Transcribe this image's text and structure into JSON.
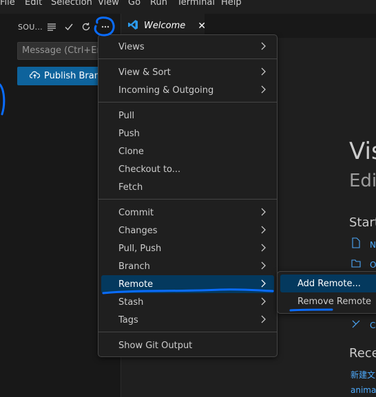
{
  "menubar": {
    "items": [
      "File",
      "Edit",
      "Selection",
      "View",
      "Go",
      "Run",
      "Terminal",
      "Help"
    ]
  },
  "sidebar": {
    "title": "SOU...",
    "message_placeholder": "Message (Ctrl+Ente",
    "publish_label": "Publish Branch",
    "icons": [
      "list-icon",
      "check-icon",
      "refresh-icon",
      "more-icon"
    ]
  },
  "tab": {
    "label": "Welcome",
    "close": "✕"
  },
  "welcome": {
    "title": "Vis",
    "subtitle": "Edit",
    "start": "Start",
    "links": [
      "N",
      "O",
      "C"
    ],
    "recent": "Rece",
    "recent_items": [
      "新建文",
      "animat"
    ]
  },
  "context_menu": {
    "items": [
      {
        "label": "Views",
        "submenu": true
      },
      {
        "label": "View & Sort",
        "submenu": true
      },
      {
        "label": "Incoming & Outgoing",
        "submenu": true
      },
      {
        "label": "Pull",
        "submenu": false
      },
      {
        "label": "Push",
        "submenu": false
      },
      {
        "label": "Clone",
        "submenu": false
      },
      {
        "label": "Checkout to...",
        "submenu": false
      },
      {
        "label": "Fetch",
        "submenu": false
      },
      {
        "label": "Commit",
        "submenu": true
      },
      {
        "label": "Changes",
        "submenu": true
      },
      {
        "label": "Pull, Push",
        "submenu": true
      },
      {
        "label": "Branch",
        "submenu": true
      },
      {
        "label": "Remote",
        "submenu": true,
        "active": true
      },
      {
        "label": "Stash",
        "submenu": true
      },
      {
        "label": "Tags",
        "submenu": true
      },
      {
        "label": "Show Git Output",
        "submenu": false
      }
    ],
    "chevron": "›"
  },
  "remote_submenu": {
    "items": [
      {
        "label": "Add Remote...",
        "active": true
      },
      {
        "label": "Remove Remote",
        "active": false
      }
    ]
  },
  "colors": {
    "accent": "#0e639c",
    "selection": "#04395e",
    "annotation": "#0a6cff",
    "link": "#4daafc"
  }
}
